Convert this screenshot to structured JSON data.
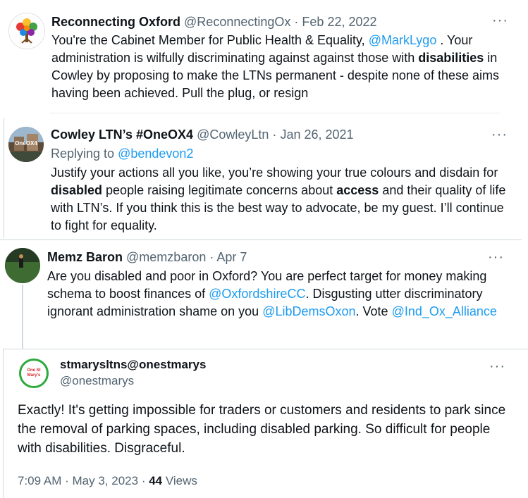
{
  "tweets": [
    {
      "name": "Reconnecting Oxford",
      "handle": "@ReconnectingOx",
      "separator": "·",
      "date": "Feb 22, 2022",
      "more": "···",
      "body": [
        {
          "t": "You're the Cabinet Member for Public Health & Equality, "
        },
        {
          "t": "@MarkLygo",
          "link": true
        },
        {
          "t": " . Your administration is wilfully discriminating against against those with "
        },
        {
          "t": "disabilities",
          "bold": true
        },
        {
          "t": " in Cowley by proposing to make the LTNs permanent - despite none of these aims having been achieved. Pull the plug, or resign"
        }
      ]
    },
    {
      "name": "Cowley LTN’s #OneOX4",
      "handle": "@CowleyLtn",
      "separator": "·",
      "date": "Jan 26, 2021",
      "more": "···",
      "replying_prefix": "Replying to ",
      "replying_to": "@bendevon2",
      "avatar_text": "OneOX4",
      "body": [
        {
          "t": "Justify your actions all you like, you’re showing your true colours and disdain for "
        },
        {
          "t": "disabled",
          "bold": true
        },
        {
          "t": " people raising legitimate concerns about "
        },
        {
          "t": "access",
          "bold": true
        },
        {
          "t": " and their quality of life with LTN’s. If you think this is the best way to advocate, be my guest. I’ll continue to fight for equality."
        }
      ]
    },
    {
      "name": "Memz Baron",
      "handle": "@memzbaron",
      "separator": "·",
      "date": "Apr 7",
      "more": "···",
      "body": [
        {
          "t": "Are you disabled and poor in Oxford? You are perfect target for money making schema to boost finances of "
        },
        {
          "t": "@OxfordshireCC",
          "link": true
        },
        {
          "t": ". Disgusting utter discriminatory ignorant administration shame on you "
        },
        {
          "t": "@LibDemsOxon",
          "link": true
        },
        {
          "t": ". Vote "
        },
        {
          "t": "@Ind_Ox_Alliance",
          "link": true
        }
      ]
    },
    {
      "name": "stmarysltns@onestmarys",
      "handle": "@onestmarys",
      "more": "···",
      "avatar_text": "One St Mary's",
      "body": [
        {
          "t": "Exactly! It's getting impossible for traders or customers and residents to park since the removal of parking spaces, including disabled parking. So difficult for people with disabilities. Disgraceful."
        }
      ],
      "time": "7:09 AM",
      "date": "May 3, 2023",
      "separator": "·",
      "views_count": "44",
      "views_label": "Views"
    }
  ],
  "colors": {
    "link": "#1d9bf0",
    "secondary": "#536471",
    "text": "#0f1419",
    "border": "#cfd9de",
    "accent_green": "#2eaa3c",
    "accent_red": "#d9262b"
  }
}
